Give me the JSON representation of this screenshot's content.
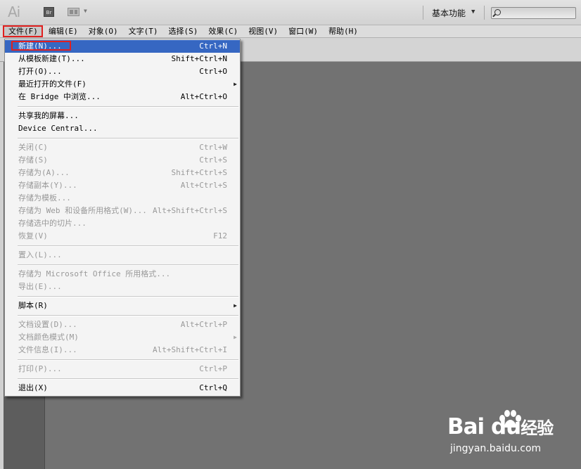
{
  "app": {
    "logo": "Ai",
    "bridge_label": "Br",
    "workspace": "基本功能"
  },
  "menubar": [
    {
      "label": "文件(F)",
      "active": true
    },
    {
      "label": "编辑(E)"
    },
    {
      "label": "对象(O)"
    },
    {
      "label": "文字(T)"
    },
    {
      "label": "选择(S)"
    },
    {
      "label": "效果(C)"
    },
    {
      "label": "视图(V)"
    },
    {
      "label": "窗口(W)"
    },
    {
      "label": "帮助(H)"
    }
  ],
  "file_menu": [
    {
      "label": "新建(N)...",
      "shortcut": "Ctrl+N",
      "highlighted": true,
      "boxed": true
    },
    {
      "label": "从模板新建(T)...",
      "shortcut": "Shift+Ctrl+N"
    },
    {
      "label": "打开(O)...",
      "shortcut": "Ctrl+O"
    },
    {
      "label": "最近打开的文件(F)",
      "shortcut": "",
      "submenu": true
    },
    {
      "label": "在 Bridge 中浏览...",
      "shortcut": "Alt+Ctrl+O"
    },
    {
      "separator": true
    },
    {
      "label": "共享我的屏幕...",
      "shortcut": ""
    },
    {
      "label": "Device Central...",
      "shortcut": ""
    },
    {
      "separator": true
    },
    {
      "label": "关闭(C)",
      "shortcut": "Ctrl+W",
      "disabled": true
    },
    {
      "label": "存储(S)",
      "shortcut": "Ctrl+S",
      "disabled": true
    },
    {
      "label": "存储为(A)...",
      "shortcut": "Shift+Ctrl+S",
      "disabled": true
    },
    {
      "label": "存储副本(Y)...",
      "shortcut": "Alt+Ctrl+S",
      "disabled": true
    },
    {
      "label": "存储为模板...",
      "shortcut": "",
      "disabled": true
    },
    {
      "label": "存储为 Web 和设备所用格式(W)...",
      "shortcut": "Alt+Shift+Ctrl+S",
      "disabled": true
    },
    {
      "label": "存储选中的切片...",
      "shortcut": "",
      "disabled": true
    },
    {
      "label": "恢复(V)",
      "shortcut": "F12",
      "disabled": true
    },
    {
      "separator": true
    },
    {
      "label": "置入(L)...",
      "shortcut": "",
      "disabled": true
    },
    {
      "separator": true
    },
    {
      "label": "存储为 Microsoft Office 所用格式...",
      "shortcut": "",
      "disabled": true
    },
    {
      "label": "导出(E)...",
      "shortcut": "",
      "disabled": true
    },
    {
      "separator": true
    },
    {
      "label": "脚本(R)",
      "shortcut": "",
      "submenu": true
    },
    {
      "separator": true
    },
    {
      "label": "文档设置(D)...",
      "shortcut": "Alt+Ctrl+P",
      "disabled": true
    },
    {
      "label": "文档颜色模式(M)",
      "shortcut": "",
      "disabled": true,
      "submenu": true
    },
    {
      "label": "文件信息(I)...",
      "shortcut": "Alt+Shift+Ctrl+I",
      "disabled": true
    },
    {
      "separator": true
    },
    {
      "label": "打印(P)...",
      "shortcut": "Ctrl+P",
      "disabled": true
    },
    {
      "separator": true
    },
    {
      "label": "退出(X)",
      "shortcut": "Ctrl+Q"
    }
  ],
  "watermark": {
    "brand": "Bai du",
    "brand_suffix": "经验",
    "site": "jingyan.baidu.com"
  },
  "colors": {
    "highlight": "#3667c2",
    "annotation_red": "#e0201f",
    "canvas": "#727272"
  }
}
